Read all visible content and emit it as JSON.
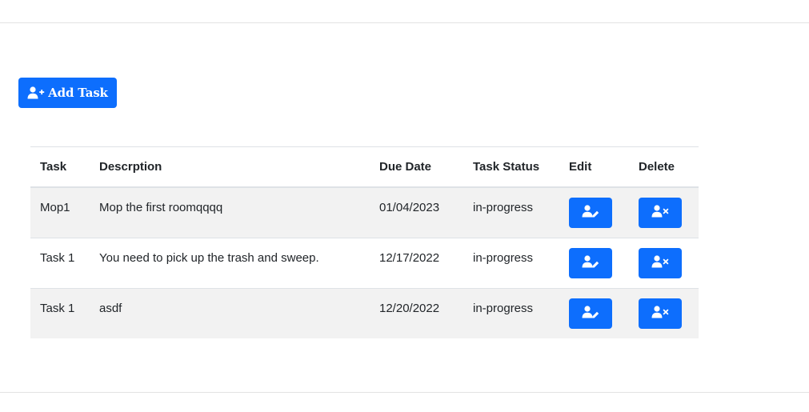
{
  "toolbar": {
    "add_task_label": "Add Task",
    "add_task_icon": "user-plus-icon"
  },
  "table": {
    "columns": [
      "Task",
      "Descrption",
      "Due Date",
      "Task Status",
      "Edit",
      "Delete"
    ],
    "rows": [
      {
        "task": "Mop1",
        "description": "Mop the first roomqqqq",
        "due_date": "01/04/2023",
        "status": "in-progress",
        "edit_icon": "user-edit-icon",
        "delete_icon": "user-times-icon"
      },
      {
        "task": "Task 1",
        "description": "You need to pick up the trash and sweep.",
        "due_date": "12/17/2022",
        "status": "in-progress",
        "edit_icon": "user-edit-icon",
        "delete_icon": "user-times-icon"
      },
      {
        "task": "Task 1",
        "description": "asdf",
        "due_date": "12/20/2022",
        "status": "in-progress",
        "edit_icon": "user-edit-icon",
        "delete_icon": "user-times-icon"
      }
    ]
  },
  "colors": {
    "primary": "#0d6efd",
    "stripe": "#f2f2f2",
    "border": "#dee2e6"
  }
}
